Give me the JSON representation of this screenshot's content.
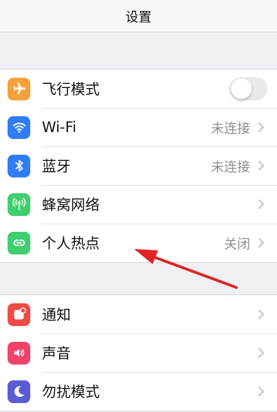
{
  "header": {
    "title": "设置"
  },
  "groups": [
    {
      "items": [
        {
          "label": "飞行模式",
          "icon": "airplane-icon",
          "icon_bg": "#f7a13a",
          "control": "toggle",
          "toggle_on": false
        },
        {
          "label": "Wi-Fi",
          "icon": "wifi-icon",
          "icon_bg": "#2f7cf6",
          "value": "未连接"
        },
        {
          "label": "蓝牙",
          "icon": "bluetooth-icon",
          "icon_bg": "#2f7cf6",
          "value": "未连接"
        },
        {
          "label": "蜂窝网络",
          "icon": "cellular-antenna-icon",
          "icon_bg": "#3fcf6e",
          "value": ""
        },
        {
          "label": "个人热点",
          "icon": "personal-hotspot-icon",
          "icon_bg": "#3fcf6e",
          "value": "关闭"
        }
      ]
    },
    {
      "items": [
        {
          "label": "通知",
          "icon": "notifications-icon",
          "icon_bg": "#f04a45"
        },
        {
          "label": "声音",
          "icon": "speaker-icon",
          "icon_bg": "#f0436a"
        },
        {
          "label": "勿扰模式",
          "icon": "moon-icon",
          "icon_bg": "#5b5bd6"
        }
      ]
    }
  ],
  "annotation": {
    "arrow_color": "#e02424",
    "points_to": "个人热点"
  }
}
